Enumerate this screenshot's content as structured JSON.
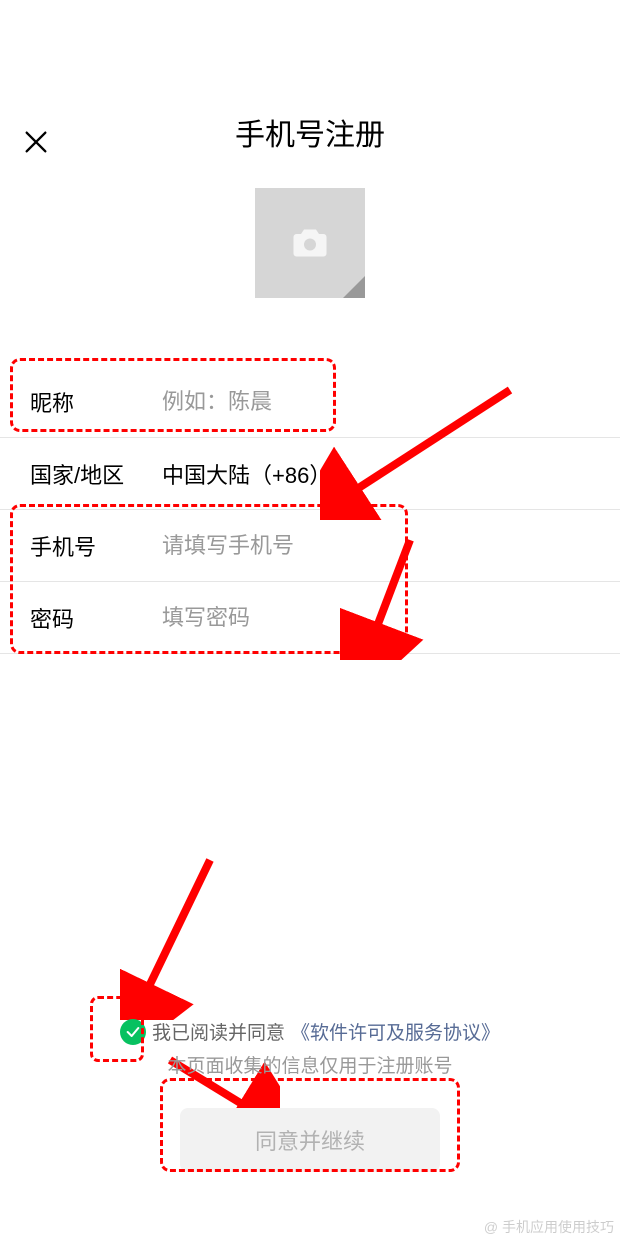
{
  "title": "手机号注册",
  "close_icon": "close-icon",
  "avatar": {
    "icon": "camera-icon"
  },
  "form": {
    "nickname": {
      "label": "昵称",
      "placeholder": "例如：陈晨",
      "value": ""
    },
    "region": {
      "label": "国家/地区",
      "value": "中国大陆（+86）"
    },
    "phone": {
      "label": "手机号",
      "placeholder": "请填写手机号",
      "value": ""
    },
    "password": {
      "label": "密码",
      "placeholder": "填写密码",
      "value": ""
    }
  },
  "agreement": {
    "checked": true,
    "prefix": "我已阅读并同意",
    "link": "《软件许可及服务协议》",
    "info": "本页面收集的信息仅用于注册账号"
  },
  "submit_label": "同意并继续",
  "watermark": "@ 手机应用使用技巧"
}
